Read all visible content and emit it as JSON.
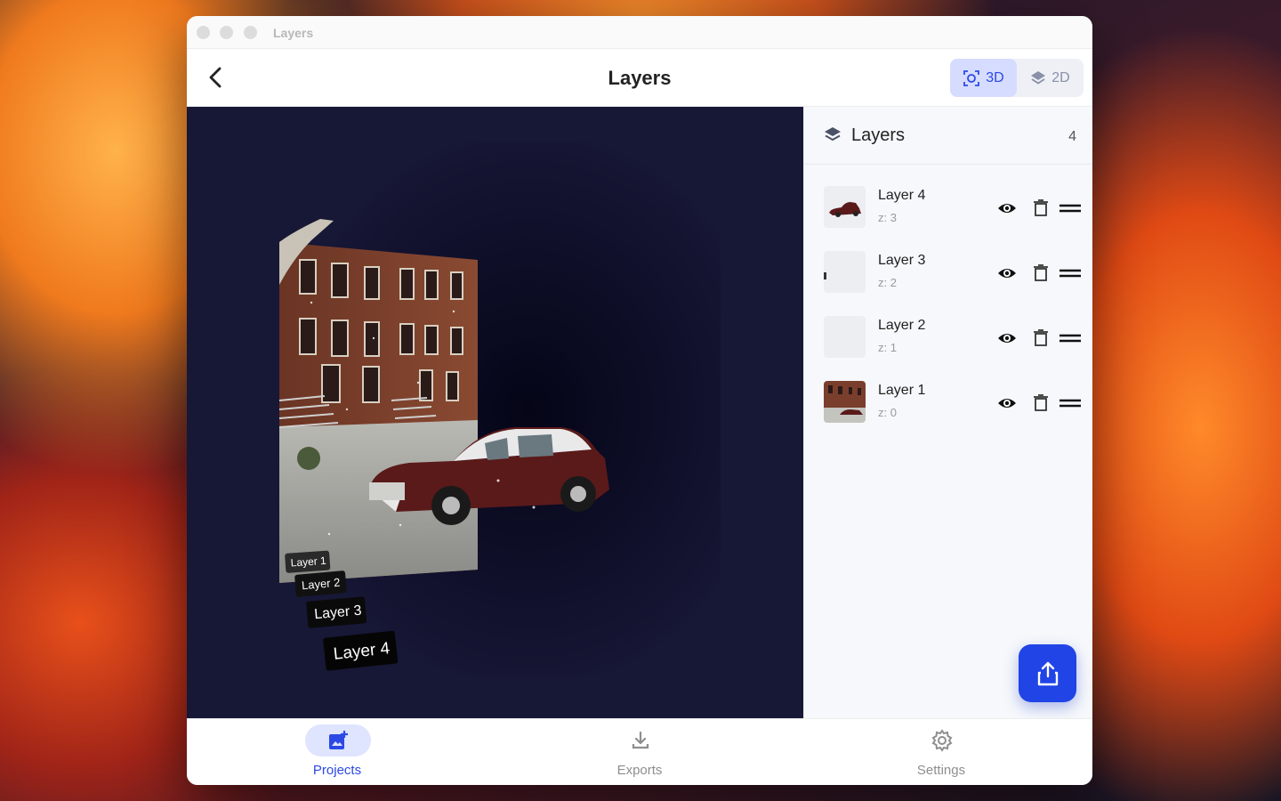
{
  "window": {
    "title": "Layers"
  },
  "header": {
    "title": "Layers",
    "back_icon": "chevron-left-icon"
  },
  "view_toggle": {
    "options": [
      {
        "label": "3D",
        "icon": "cube-scan-icon",
        "active": true
      },
      {
        "label": "2D",
        "icon": "layers-icon",
        "active": false
      }
    ]
  },
  "stage": {
    "tags": [
      "Layer 1",
      "Layer 2",
      "Layer 3",
      "Layer 4"
    ]
  },
  "panel": {
    "title": "Layers",
    "count": "4",
    "layers": [
      {
        "name": "Layer 4",
        "z": "z: 3"
      },
      {
        "name": "Layer 3",
        "z": "z: 2"
      },
      {
        "name": "Layer 2",
        "z": "z: 1"
      },
      {
        "name": "Layer 1",
        "z": "z: 0"
      }
    ]
  },
  "fab": {
    "icon": "share-icon"
  },
  "tabs": [
    {
      "label": "Projects",
      "icon": "add-photo-icon",
      "active": true
    },
    {
      "label": "Exports",
      "icon": "download-icon",
      "active": false
    },
    {
      "label": "Settings",
      "icon": "gear-icon",
      "active": false
    }
  ],
  "colors": {
    "accent": "#2c49e6",
    "stage_bg": "#171736",
    "fab": "#2044e6"
  }
}
